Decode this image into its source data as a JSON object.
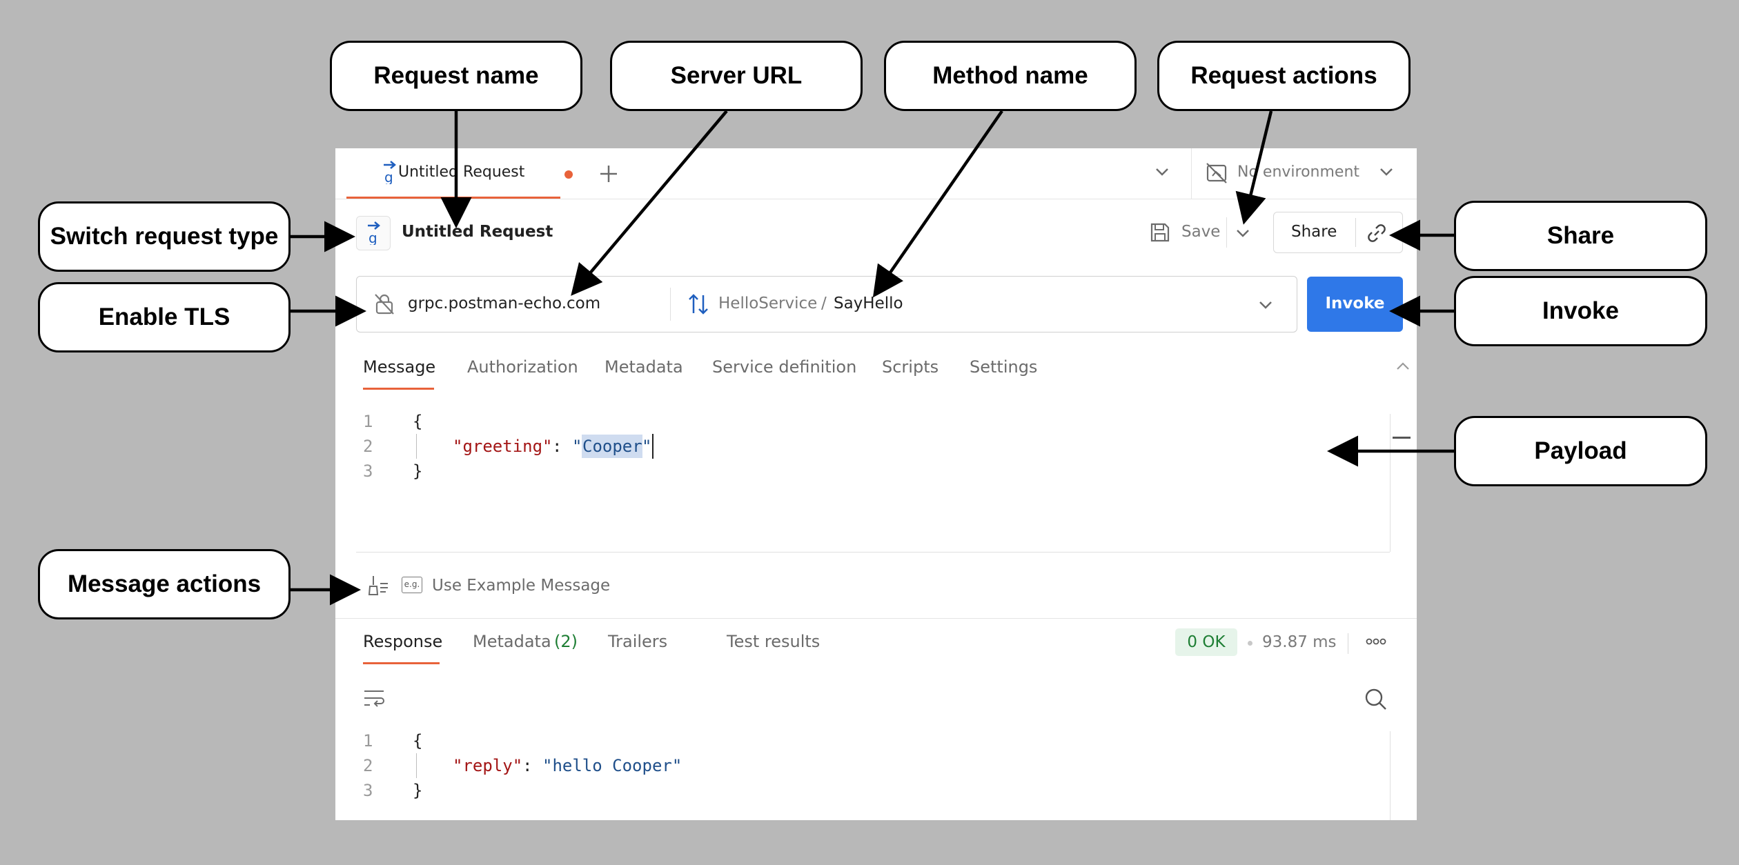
{
  "callouts": {
    "request_name": "Request name",
    "server_url": "Server URL",
    "method_name": "Method name",
    "request_actions": "Request actions",
    "switch_request_type": "Switch request type",
    "enable_tls": "Enable TLS",
    "share": "Share",
    "invoke": "Invoke",
    "payload": "Payload",
    "message_actions": "Message actions"
  },
  "tabbar": {
    "tab_title": "Untitled Request",
    "environment": "No environment"
  },
  "header": {
    "request_title": "Untitled Request",
    "save_label": "Save",
    "share_label": "Share"
  },
  "urlbar": {
    "url": "grpc.postman-echo.com",
    "service": "HelloService",
    "separator": "/",
    "method": "SayHello",
    "invoke_label": "Invoke"
  },
  "request_tabs": [
    "Message",
    "Authorization",
    "Metadata",
    "Service definition",
    "Scripts",
    "Settings"
  ],
  "message_editor": {
    "line_numbers": [
      "1",
      "2",
      "3"
    ],
    "open_brace": "{",
    "key": "\"greeting\"",
    "colon": ": ",
    "value_quote_open": "\"",
    "value": "Cooper",
    "value_quote_close": "\"",
    "close_brace": "}"
  },
  "message_actions": {
    "example_icon_text": "e.g.",
    "use_example_label": "Use Example Message"
  },
  "response_tabs": {
    "response": "Response",
    "metadata": "Metadata",
    "metadata_count": "(2)",
    "trailers": "Trailers",
    "test_results": "Test results"
  },
  "response_status": {
    "status": "0 OK",
    "time": "93.87 ms"
  },
  "response_editor": {
    "line_numbers": [
      "1",
      "2",
      "3"
    ],
    "open_brace": "{",
    "key": "\"reply\"",
    "colon": ": ",
    "value": "\"hello Cooper\"",
    "close_brace": "}"
  },
  "colors": {
    "accent_orange": "#e8623a",
    "invoke_blue": "#2f78e8",
    "grpc_blue": "#1f5fbf",
    "status_green_bg": "#e6f4ea",
    "status_green_text": "#1e7e34",
    "json_key": "#a31515",
    "json_string": "#1f4f8a"
  }
}
